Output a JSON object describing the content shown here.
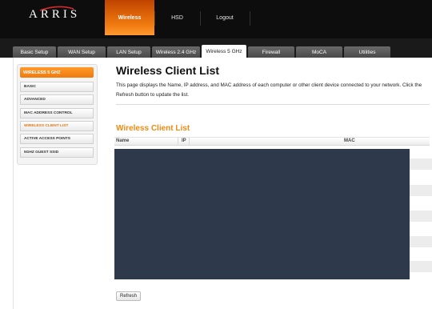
{
  "header": {
    "logo_text": "ARRIS",
    "nav": [
      {
        "label": "Wireless",
        "active": true
      },
      {
        "label": "HSD",
        "active": false
      },
      {
        "label": "Logout",
        "active": false
      }
    ]
  },
  "tabs": [
    {
      "label": "Basic Setup"
    },
    {
      "label": "WAN Setup"
    },
    {
      "label": "LAN Setup"
    },
    {
      "label": "Wireless 2.4 GHz"
    },
    {
      "label": "Wireless 5 GHz",
      "active": true
    },
    {
      "label": "Firewall"
    },
    {
      "label": "MoCA"
    },
    {
      "label": "Utilities"
    }
  ],
  "sidebar": {
    "heading": "WIRELESS 5 GHZ",
    "items": [
      {
        "label": "BASIC"
      },
      {
        "label": "ADVANCED"
      },
      {
        "label": "MAC ADDRESS CONTROL"
      },
      {
        "label": "WIRELESS CLIENT LIST",
        "active": true
      },
      {
        "label": "ACTIVE ACCESS POINTS"
      },
      {
        "label": "5GHZ GUEST SSID"
      }
    ]
  },
  "main": {
    "title": "Wireless Client List",
    "intro": "This page displays the Name, IP address, and MAC address of each computer or other client device connected to your network. Click the Refresh button to update the list.",
    "section_title": "Wireless Client List",
    "columns": [
      "Name",
      "IP",
      "MAC"
    ],
    "refresh_label": "Refresh"
  },
  "colors": {
    "accent": "#f08a10",
    "redacted_area": "#2e3a4b",
    "header_bg": "#0d0d0d"
  }
}
